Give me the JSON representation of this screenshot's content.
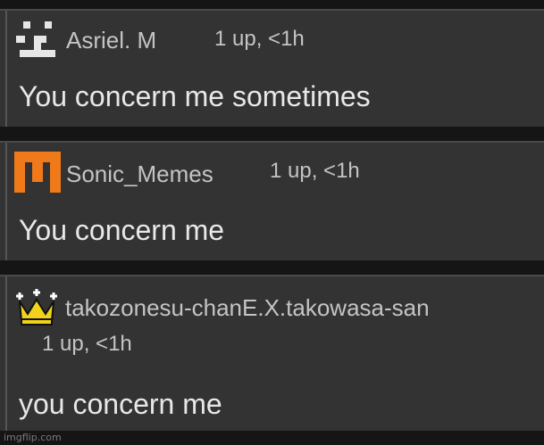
{
  "comments": [
    {
      "avatar_icon": "pixel-face-icon",
      "username": "Asriel.   M",
      "meta": "1 up, <1h",
      "text": "You concern me sometimes"
    },
    {
      "avatar_icon": "orange-m-logo-icon",
      "username": "Sonic_Memes",
      "meta": "1 up, <1h",
      "text": "You concern me"
    },
    {
      "avatar_icon": "crown-icon",
      "username": "takozonesu-chanE.X.takowasa-san",
      "meta": "1 up, <1h",
      "text": "you concern me"
    }
  ],
  "watermark": "imgflip.com",
  "colors": {
    "background": "#151515",
    "card": "#333333",
    "orange_logo": "#f07a1a",
    "crown": "#f1d21c"
  }
}
